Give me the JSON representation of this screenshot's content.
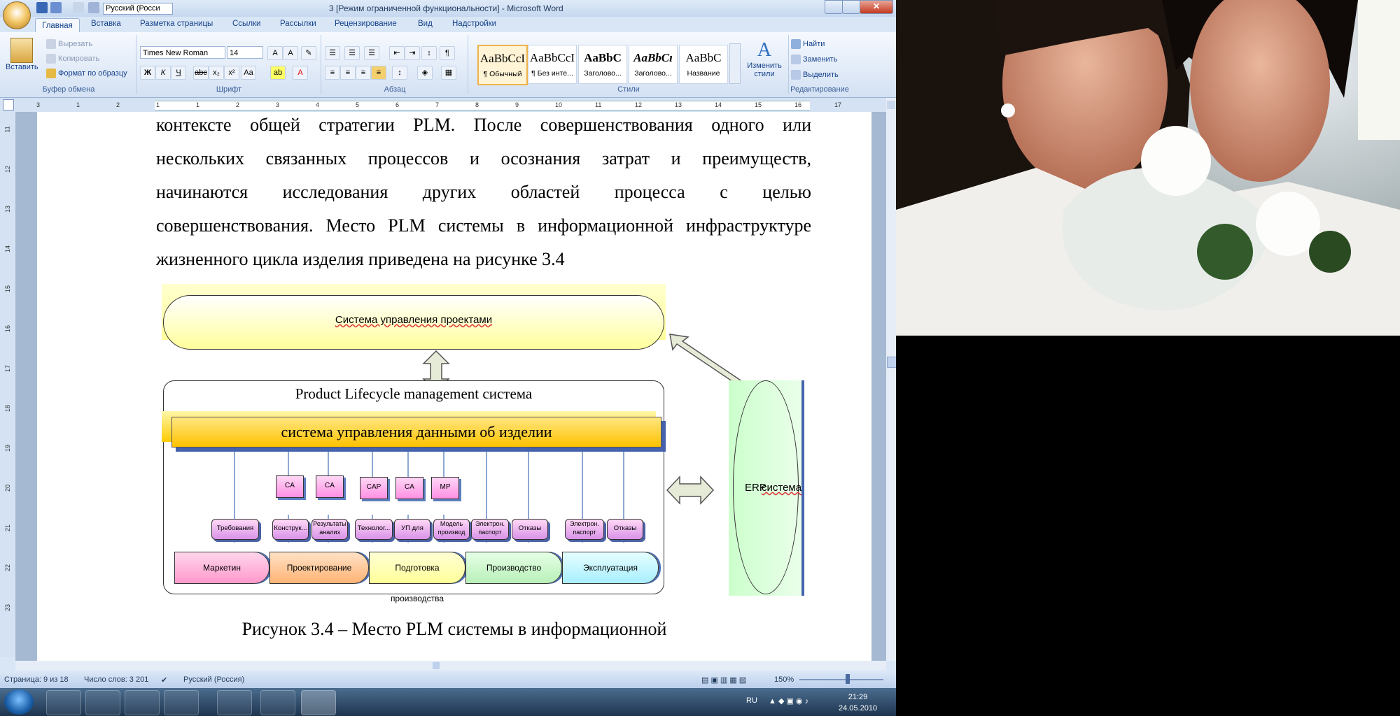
{
  "window": {
    "title": "3 [Режим ограниченной функциональности] - Microsoft Word",
    "language_combo": "Русский (Росси"
  },
  "tabs": [
    "Главная",
    "Вставка",
    "Разметка страницы",
    "Ссылки",
    "Рассылки",
    "Рецензирование",
    "Вид",
    "Надстройки"
  ],
  "ribbon": {
    "clipboard": {
      "label": "Буфер обмена",
      "paste": "Вставить",
      "cut": "Вырезать",
      "copy": "Копировать",
      "format_painter": "Формат по образцу"
    },
    "font": {
      "label": "Шрифт",
      "family": "Times New Roman",
      "size": "14"
    },
    "paragraph": {
      "label": "Абзац"
    },
    "styles": {
      "label": "Стили",
      "items": [
        {
          "preview": "AaBbCcI",
          "name": "¶ Обычный"
        },
        {
          "preview": "AaBbCcI",
          "name": "¶ Без инте..."
        },
        {
          "preview": "AaBbC",
          "name": "Заголово..."
        },
        {
          "preview": "AaBbCı",
          "name": "Заголово..."
        },
        {
          "preview": "AaBbC",
          "name": "Название"
        }
      ],
      "change": "Изменить стили"
    },
    "editing": {
      "label": "Редактирование",
      "find": "Найти",
      "replace": "Заменить",
      "select": "Выделить"
    }
  },
  "ruler": {
    "h_numbers": [
      "3",
      "1",
      "2",
      "1",
      "1",
      "2",
      "3",
      "4",
      "5",
      "6",
      "7",
      "8",
      "9",
      "10",
      "11",
      "12",
      "13",
      "14",
      "15",
      "16",
      "17"
    ],
    "v_numbers": [
      "11",
      "12",
      "13",
      "14",
      "15",
      "16",
      "17",
      "18",
      "19",
      "20",
      "21",
      "22",
      "23"
    ]
  },
  "document": {
    "lines": [
      "контексте общей стратегии PLM. После совершенствования одного или",
      "нескольких связанных процессов и осознания затрат и преимуществ,",
      "начинаются исследования других областей процесса с целью",
      "совершенствования. Место PLM системы в информационной инфраструктуре",
      "жизненного цикла изделия приведена на рисунке 3.4"
    ],
    "caption": "Рисунок 3.4 – Место PLM системы в информационной"
  },
  "diagram": {
    "project_system": "Система управления проектами",
    "plm_title": "Product Lifecycle management система",
    "pdm": "система управления данными об изделии",
    "erp_a": "ERP",
    "erp_b": "система",
    "tools": [
      "CA",
      "CA",
      "CAP",
      "CA",
      "MP"
    ],
    "docs": [
      "Требования",
      "Конструк...",
      "Результаты анализ",
      "Технолог...",
      "УП для",
      "Модель производ",
      "Электрон. паспорт",
      "Отказы",
      "Электрон. паспорт",
      "Отказы"
    ],
    "phases": [
      "Маркетин",
      "Проектирование",
      "Подготовка производства",
      "Производство",
      "Эксплуатация"
    ]
  },
  "statusbar": {
    "page": "Страница: 9 из 18",
    "words": "Число слов: 3 201",
    "language": "Русский (Россия)",
    "zoom": "150%"
  },
  "taskbar": {
    "lang": "RU",
    "time": "21:29",
    "date": "24.05.2010"
  },
  "colors": {
    "ribbon": "#d3e1f3",
    "pdm_bar": "#ffcc00",
    "erp_fill": "#ccffcc"
  }
}
